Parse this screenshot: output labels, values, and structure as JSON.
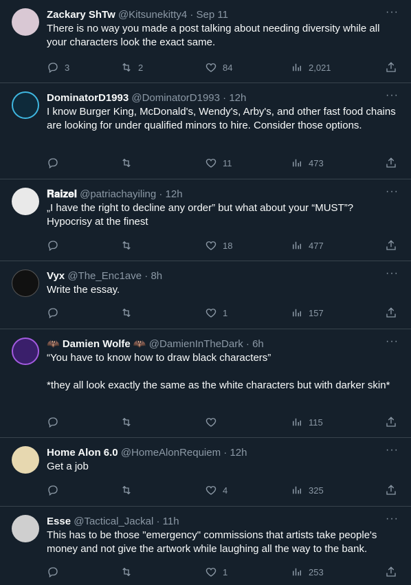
{
  "tweets": [
    {
      "name": "Zackary ShTw",
      "handle": "@Kitsunekitty4",
      "time": "· Sep 11",
      "text": "There is no way you made a post talking about needing diversity while all your characters look the exact same.",
      "replies": "3",
      "retweets": "2",
      "likes": "84",
      "views": "2,021",
      "avatar_color": "#d9c8d4"
    },
    {
      "name": "DominatorD1993",
      "handle": "@DominatorD1993",
      "time": "· 12h",
      "text": "I know Burger King, McDonald's, Wendy's, Arby's, and other fast food chains are looking for under qualified minors to hire. Consider those options.",
      "replies": "",
      "retweets": "",
      "likes": "11",
      "views": "473",
      "avatar_color": "#0e2a3a"
    },
    {
      "name": "𝐑𝐚𝐢𝐳𝐞𝐥",
      "handle": "@patriachayiling",
      "time": "· 12h",
      "text": "„I have the right to decline any order” but what about your “MUST”? Hypocrisy at the finest",
      "replies": "",
      "retweets": "",
      "likes": "18",
      "views": "477",
      "avatar_color": "#e9e9e9"
    },
    {
      "name": "Vyx",
      "handle": "@The_Enc1ave",
      "time": "· 8h",
      "text": "Write the essay.",
      "replies": "",
      "retweets": "",
      "likes": "1",
      "views": "157",
      "avatar_color": "#111111"
    },
    {
      "name": "🦇 Damien Wolfe 🦇",
      "handle": "@DamienInTheDark",
      "time": "· 6h",
      "text": "“You have to know how to draw black characters”\n\n*they all look exactly the same as the white characters but with darker skin*",
      "replies": "",
      "retweets": "",
      "likes": "",
      "views": "115",
      "avatar_color": "#3a1f6b"
    },
    {
      "name": "Home Alon 6.0",
      "handle": "@HomeAlonRequiem",
      "time": "· 12h",
      "text": "Get a job",
      "replies": "",
      "retweets": "",
      "likes": "4",
      "views": "325",
      "avatar_color": "#e7d8b0"
    },
    {
      "name": "Esse",
      "handle": "@Tactical_Jackal",
      "time": "· 11h",
      "text": "This has to be those \"emergency\" commissions that artists take people's money and not give the artwork while laughing all the way to the bank.",
      "replies": "",
      "retweets": "",
      "likes": "1",
      "views": "253",
      "avatar_color": "#cfcfcf"
    }
  ],
  "more_glyph": "···"
}
